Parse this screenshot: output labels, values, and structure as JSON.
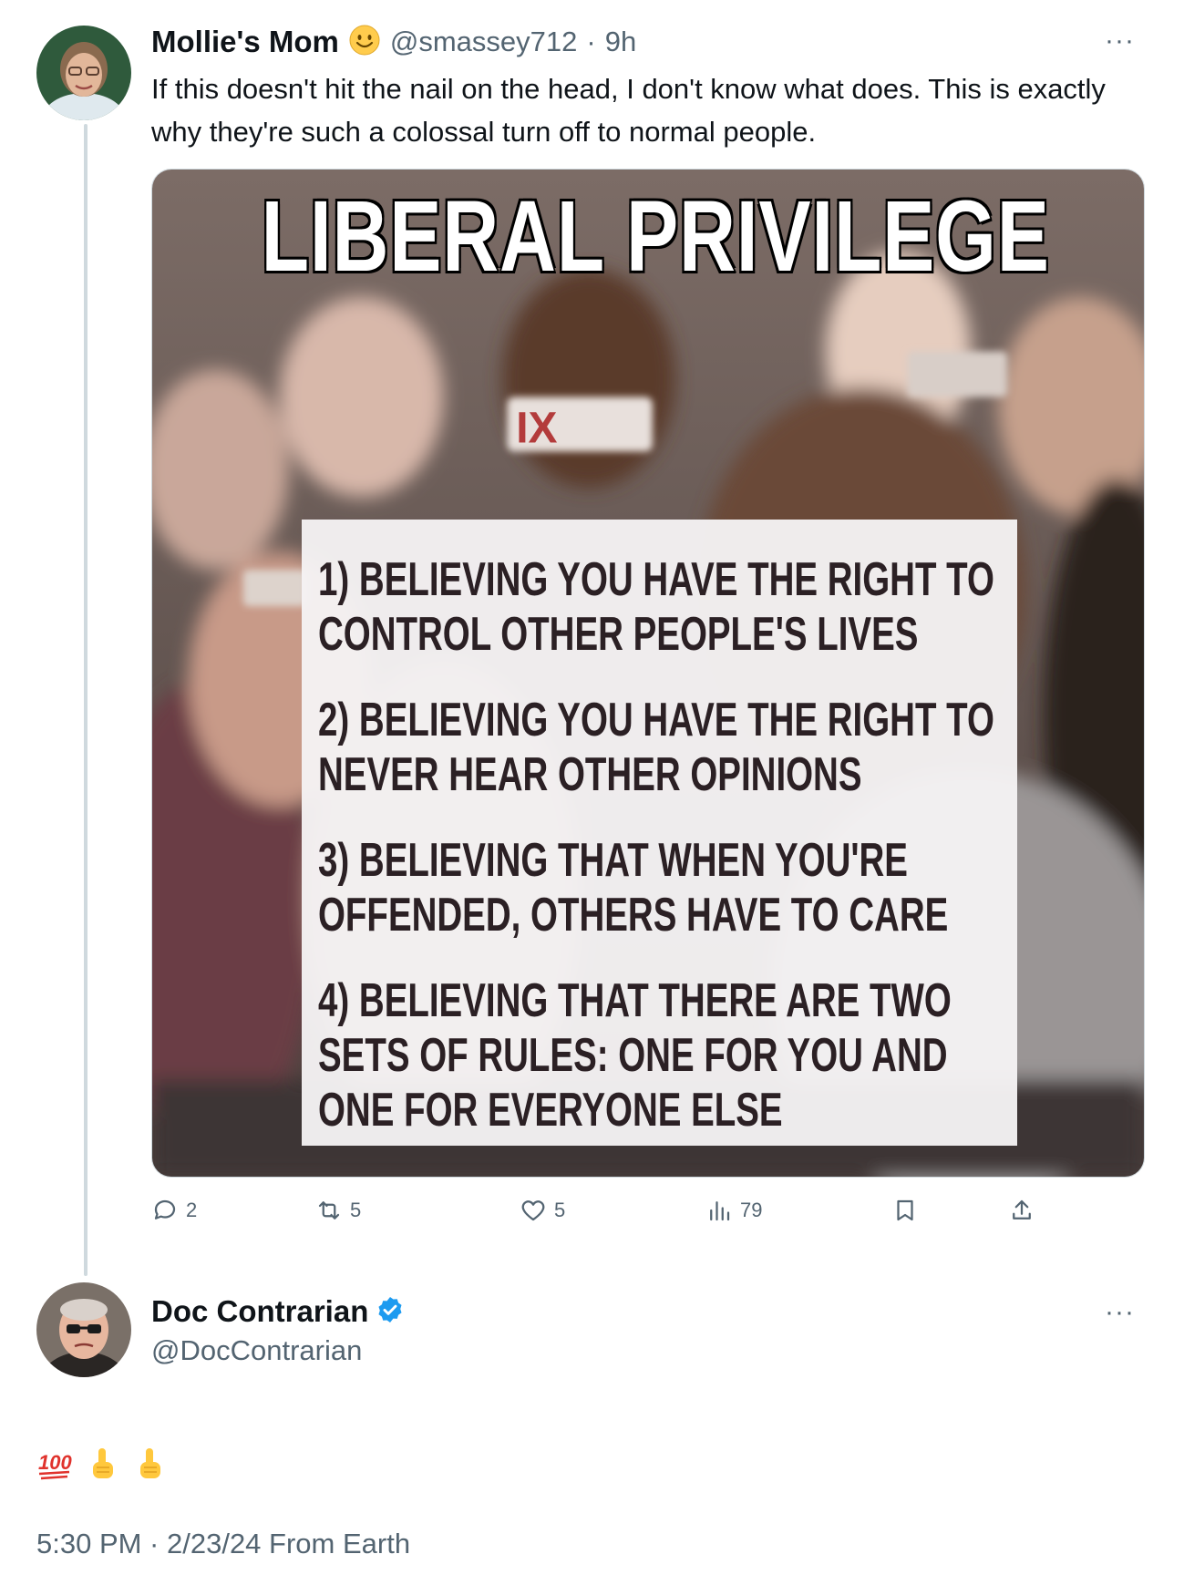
{
  "tweet1": {
    "display_name": "Mollie's Mom",
    "handle": "@smassey712",
    "separator": "·",
    "age": "9h",
    "text": "If this doesn't hit the nail on the head, I don't know what does. This is exactly why they're such a colossal turn off to normal people.",
    "meme": {
      "title": "LIBERAL PRIVILEGE",
      "sign_text": "IX",
      "items": [
        "1) Believing you have the right to control other people's lives",
        "2) Believing you have the right to never hear other opinions",
        "3) Believing that when you're offended, others have to care",
        "4) Believing that there are two sets of rules: one for you and one for everyone else"
      ]
    },
    "actions": {
      "replies": "2",
      "reposts": "5",
      "likes": "5",
      "views": "79"
    },
    "more_label": "···"
  },
  "tweet2": {
    "display_name": "Doc Contrarian",
    "handle": "@DocContrarian",
    "more_label": "···",
    "emojis": [
      "hundred-points",
      "pointing-up",
      "pointing-up"
    ],
    "timestamp": "5:30 PM · 2/23/24 From Earth"
  },
  "colors": {
    "text_primary": "#0f1419",
    "text_secondary": "#536471",
    "thread_line": "#cfd9de",
    "verified_blue": "#1d9bf0"
  }
}
